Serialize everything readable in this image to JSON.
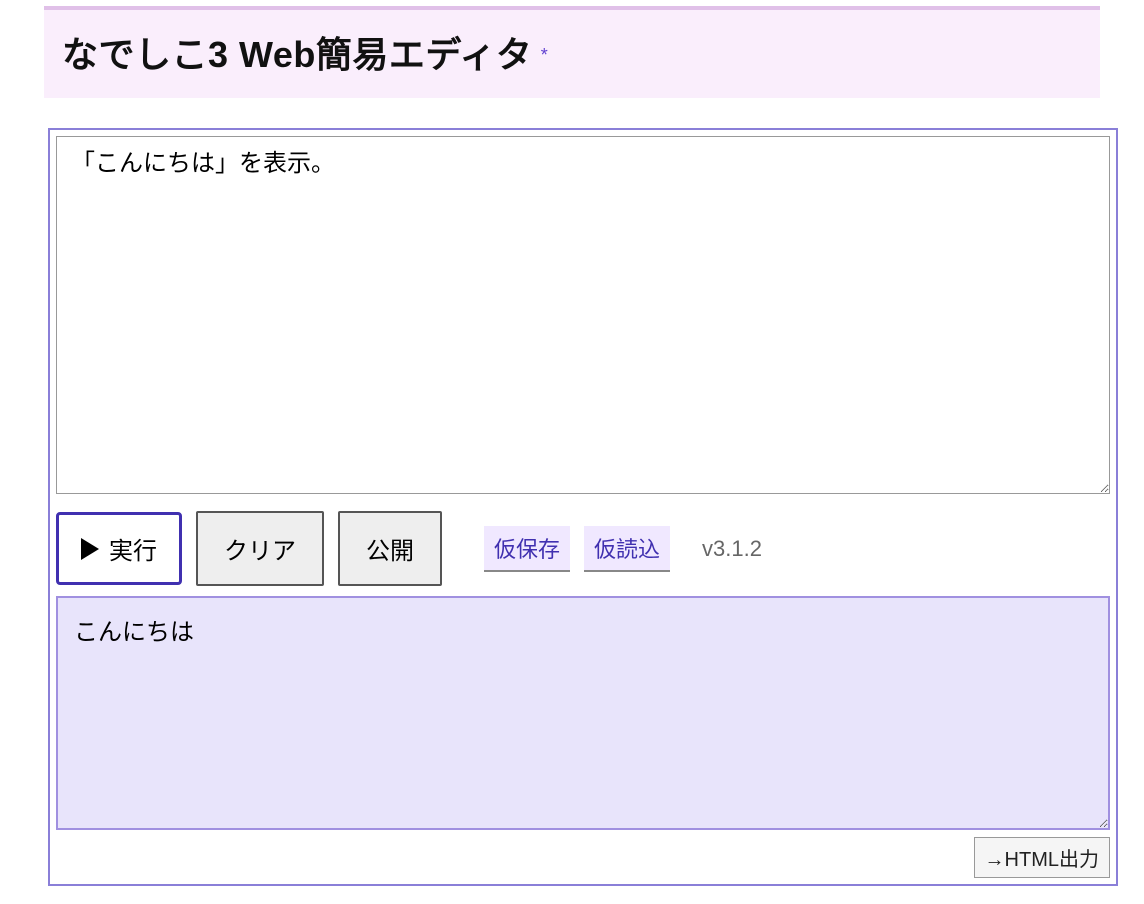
{
  "header": {
    "title": "なでしこ3 Web簡易エディタ",
    "asterisk": "*"
  },
  "editor": {
    "code_value": "「こんにちは」を表示。"
  },
  "toolbar": {
    "run_label": "実行",
    "clear_label": "クリア",
    "publish_label": "公開",
    "temp_save_label": "仮保存",
    "temp_load_label": "仮読込",
    "version_label": "v3.1.2"
  },
  "output": {
    "value": "こんにちは"
  },
  "footer": {
    "html_export_label": "→HTML出力"
  }
}
